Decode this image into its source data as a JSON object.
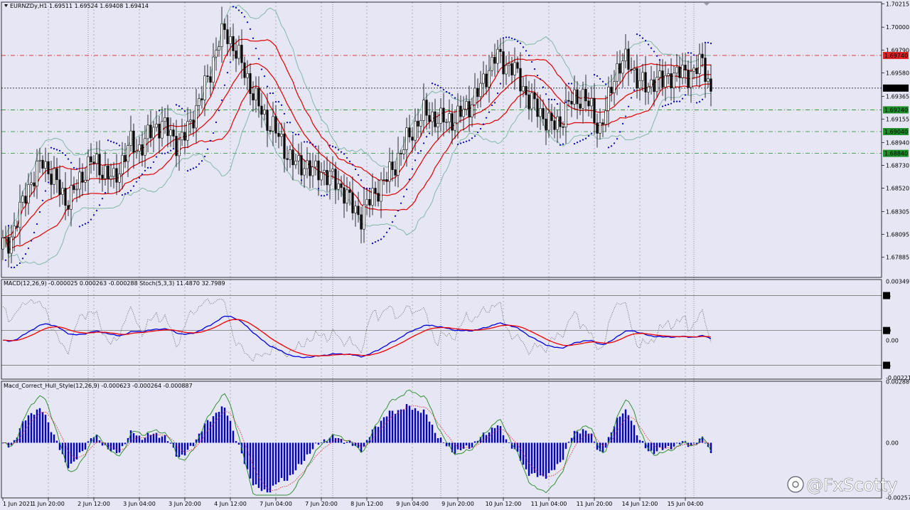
{
  "app": {
    "symbol_label": "EURNZDy,H1",
    "ohlc": "1.69511 1.69524 1.69408 1.69414",
    "watermark": "@FxScotty"
  },
  "colors": {
    "background": "#e6e6f4",
    "bull_candle": "#ffffff",
    "bear_candle": "#000000",
    "bollinger_mid": "#e00000",
    "bollinger_outer": "#78b4a0",
    "parabolic_sar": "#0000cc",
    "macd_main": "#0000dd",
    "macd_signal": "#ee0000",
    "stochastic": "#555555",
    "hist": "#0000cc",
    "level_red": "#dd2222",
    "level_green": "#1f8f2a",
    "current_price": "#000000"
  },
  "chart_data": [
    {
      "type": "candlestick",
      "panel": "main",
      "title": "EURNZDy,H1",
      "ylim": [
        1.677,
        1.7023
      ],
      "y_ticks": [
        "1.70215",
        "1.70000",
        "1.69790",
        "1.69580",
        "1.69365",
        "1.69155",
        "1.68940",
        "1.68730",
        "1.68520",
        "1.68305",
        "1.68095",
        "1.67885"
      ],
      "price_labels": [
        {
          "label": "1.69740",
          "value": 1.6974,
          "color": "#dd2222"
        },
        {
          "label": "1.69440",
          "value": 1.6944,
          "color": "#000000"
        },
        {
          "label": "1.69240",
          "value": 1.6924,
          "color": "#1f8f2a"
        },
        {
          "label": "1.69040",
          "value": 1.6904,
          "color": "#1f8f2a"
        },
        {
          "label": "1.68840",
          "value": 1.6884,
          "color": "#1f8f2a"
        }
      ],
      "x_labels": [
        "1 Jun 2021",
        "1 Jun 20:00",
        "2 Jun 12:00",
        "3 Jun 04:00",
        "3 Jun 20:00",
        "4 Jun 12:00",
        "7 Jun 04:00",
        "7 Jun 20:00",
        "8 Jun 12:00",
        "9 Jun 04:00",
        "9 Jun 20:00",
        "10 Jun 12:00",
        "11 Jun 04:00",
        "11 Jun 20:00",
        "14 Jun 12:00",
        "15 Jun 04:00"
      ],
      "close": [
        1.6799,
        1.6806,
        1.6826,
        1.6852,
        1.6862,
        1.6878,
        1.6865,
        1.6853,
        1.684,
        1.6849,
        1.6864,
        1.6877,
        1.6872,
        1.6866,
        1.6858,
        1.6878,
        1.6893,
        1.6888,
        1.6896,
        1.6908,
        1.6911,
        1.6902,
        1.6893,
        1.6901,
        1.6921,
        1.6937,
        1.6958,
        1.6985,
        1.6997,
        1.6982,
        1.6966,
        1.6948,
        1.6929,
        1.6916,
        1.6908,
        1.6894,
        1.6881,
        1.6872,
        1.6875,
        1.6866,
        1.6869,
        1.6862,
        1.6857,
        1.6848,
        1.6834,
        1.6826,
        1.6839,
        1.6851,
        1.6858,
        1.6871,
        1.6884,
        1.6899,
        1.6912,
        1.6921,
        1.6918,
        1.6913,
        1.6916,
        1.6915,
        1.6924,
        1.6932,
        1.6943,
        1.6961,
        1.6974,
        1.6967,
        1.6963,
        1.6951,
        1.6935,
        1.6926,
        1.6918,
        1.6909,
        1.6912,
        1.6929,
        1.6934,
        1.6937,
        1.6923,
        1.6906,
        1.6928,
        1.6961,
        1.6969,
        1.6963,
        1.6951,
        1.6942,
        1.6955,
        1.6948,
        1.6957,
        1.6958,
        1.6956,
        1.6961,
        1.6968,
        1.6941
      ],
      "bollinger": {
        "period": 20,
        "deviations": 2
      },
      "parabolic_sar": {
        "step": 0.02,
        "max": 0.2
      }
    },
    {
      "type": "line",
      "panel": "oscillator",
      "title": "MACD(12,26,9) -0.000025 0.000263 -0.000288  Stoch(5,3,3) 11.4870 32.7989",
      "ylim": [
        -0.0023,
        0.0036
      ],
      "y_ticks": [
        "0.003497",
        "0.00",
        "-0.002211"
      ],
      "levels": [
        {
          "label": "85",
          "value": 0.00265
        },
        {
          "label": "50",
          "value": 0.00058
        },
        {
          "label": "15",
          "value": -0.00148
        }
      ],
      "series": [
        {
          "name": "MACD(12,26,9)",
          "color": "#0000dd",
          "source": "macd_main"
        },
        {
          "name": "",
          "color": "#ee0000",
          "source": "macd_signal"
        },
        {
          "name": "Stoch(5,3,3)",
          "color": "#555555",
          "source": "stochastic",
          "style": "dotted"
        }
      ]
    },
    {
      "type": "bar",
      "panel": "histogram",
      "title": "Macd_Correct_Hull_Style(12,26,9) -0.000623 -0.000264 -0.000887",
      "ylim": [
        -0.0026,
        0.0029
      ],
      "y_ticks": [
        "0.002889",
        "0.00",
        "-0.002577"
      ],
      "series": [
        {
          "name": "",
          "color": "#0000cc",
          "source": "histogram"
        },
        {
          "name": "",
          "color": "#228822",
          "source": "hull_line"
        },
        {
          "name": "",
          "color": "#dd2222",
          "source": "hull_signal",
          "style": "dotted"
        }
      ]
    }
  ]
}
